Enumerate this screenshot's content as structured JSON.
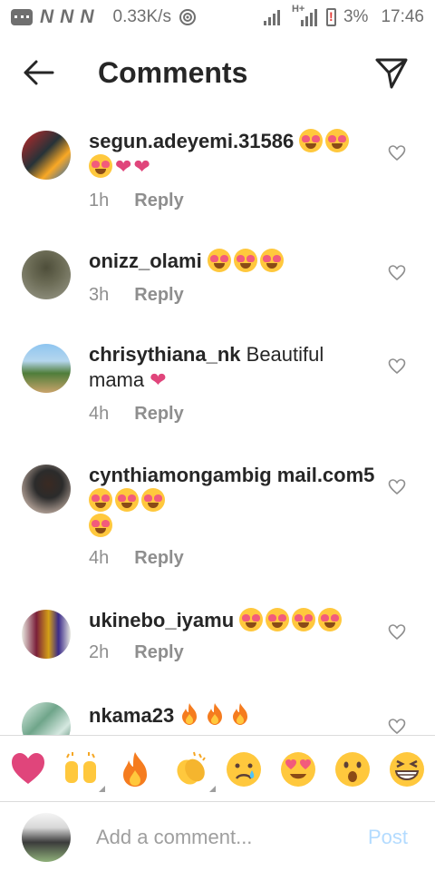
{
  "status_bar": {
    "carrier_marks": [
      "N",
      "N",
      "N"
    ],
    "net_speed": "0.33K/s",
    "network_type": "H+",
    "battery": "3%",
    "time": "17:46"
  },
  "header": {
    "title": "Comments",
    "back_icon": "arrow-left-icon",
    "send_icon": "paper-plane-icon"
  },
  "comments": [
    {
      "username": "segun.adeyemi.31586",
      "text": "",
      "emojis": [
        "heart-eyes",
        "heart-eyes",
        "heart-eyes",
        "pink-heart",
        "pink-heart"
      ],
      "time": "1h",
      "reply": "Reply"
    },
    {
      "username": "onizz_olami",
      "text": "",
      "emojis": [
        "heart-eyes",
        "heart-eyes",
        "heart-eyes"
      ],
      "time": "3h",
      "reply": "Reply"
    },
    {
      "username": "chrisythiana_nk",
      "text": "Beautiful mama",
      "emojis": [
        "pink-heart"
      ],
      "time": "4h",
      "reply": "Reply"
    },
    {
      "username": "cynthiamongambig mail.com5",
      "text": "",
      "emojis": [
        "heart-eyes",
        "heart-eyes",
        "heart-eyes",
        "heart-eyes"
      ],
      "time": "4h",
      "reply": "Reply"
    },
    {
      "username": "ukinebo_iyamu",
      "text": "",
      "emojis": [
        "heart-eyes",
        "heart-eyes",
        "heart-eyes",
        "heart-eyes"
      ],
      "time": "2h",
      "reply": "Reply"
    },
    {
      "username": "nkama23",
      "text": "",
      "emojis": [
        "fire",
        "fire",
        "fire"
      ],
      "time": "",
      "reply": ""
    }
  ],
  "emoji_bar": [
    "red-heart",
    "raising-hands",
    "fire",
    "clapping-hands",
    "crying-face",
    "heart-eyes",
    "astonished-face",
    "grinning-squinting-face"
  ],
  "composer": {
    "placeholder": "Add a comment...",
    "post_label": "Post"
  },
  "colors": {
    "text": "#262626",
    "meta": "#8e8e8e",
    "post_disabled": "#b3dbff",
    "pink_heart": "#e0457b"
  }
}
